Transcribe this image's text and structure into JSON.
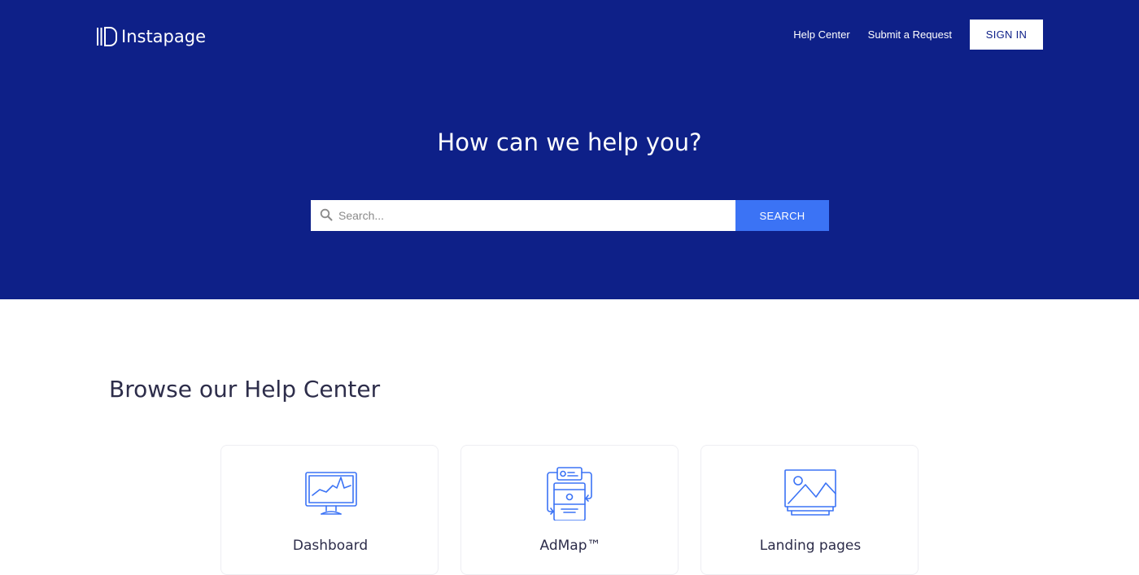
{
  "brand": {
    "name": "Instapage",
    "hero_color": "#0e2088",
    "accent_color": "#3b73f5"
  },
  "header": {
    "nav": {
      "help_center": "Help Center",
      "submit_request": "Submit a Request",
      "sign_in": "SIGN IN"
    }
  },
  "hero": {
    "title": "How can we help you?",
    "search": {
      "placeholder": "Search...",
      "value": "",
      "button_label": "SEARCH",
      "icon": "search-icon"
    }
  },
  "browse": {
    "title": "Browse our Help Center",
    "categories": [
      {
        "label": "Dashboard",
        "icon": "monitor-chart-icon"
      },
      {
        "label": "AdMap™",
        "icon": "admap-flow-icon"
      },
      {
        "label": "Landing pages",
        "icon": "landing-page-image-icon"
      }
    ]
  }
}
